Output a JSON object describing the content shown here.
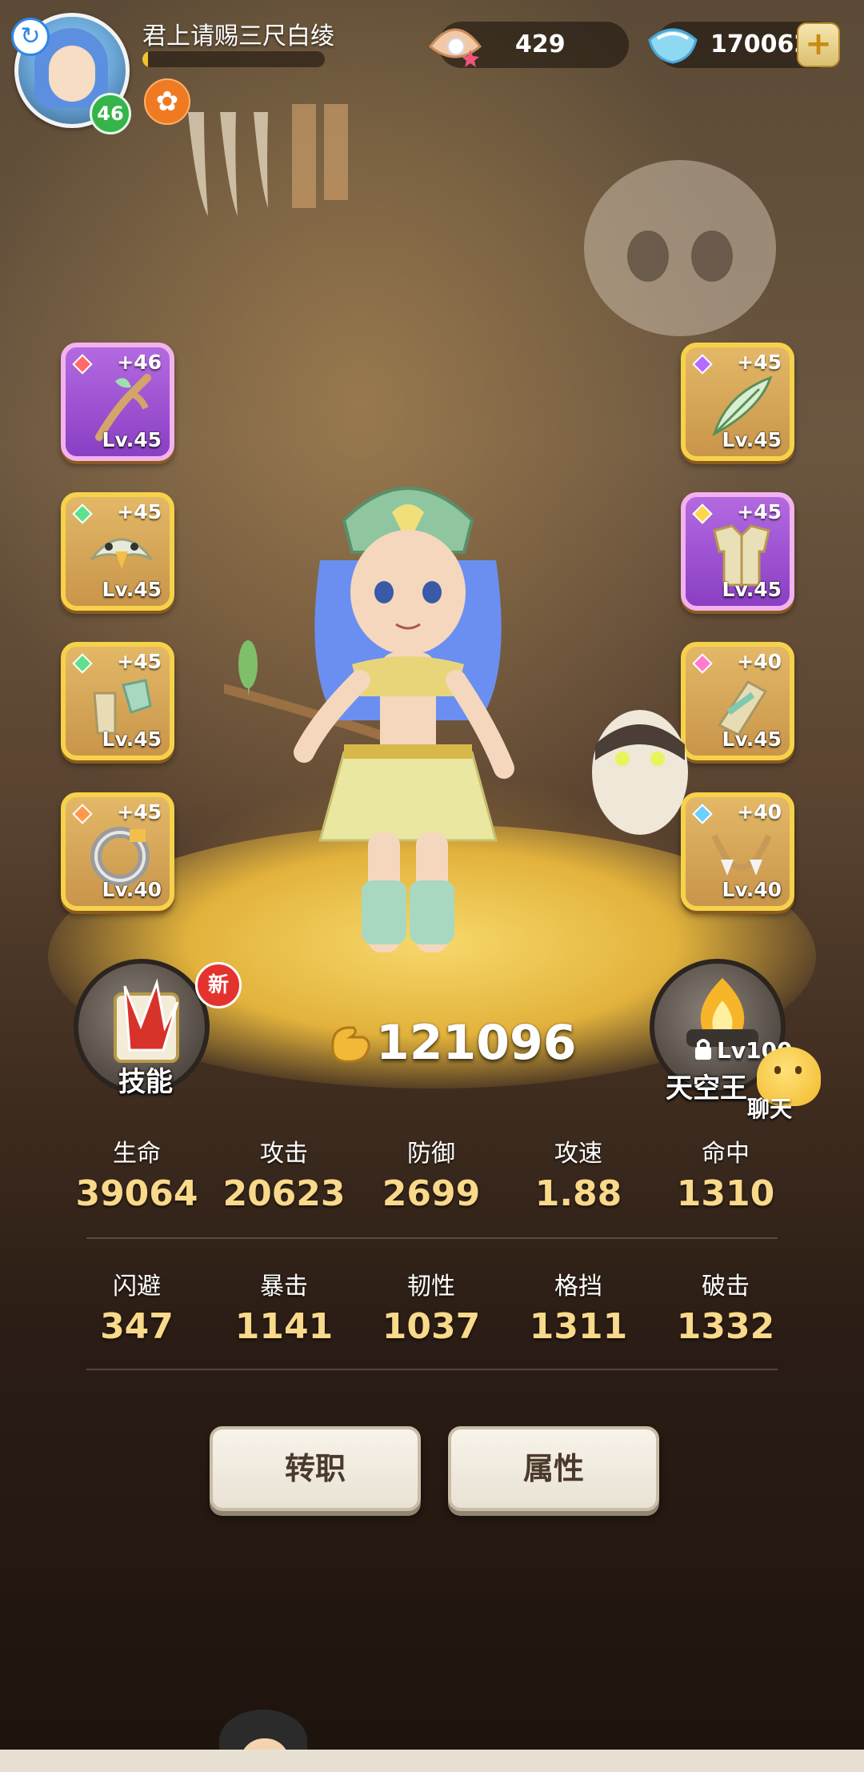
{
  "header": {
    "player_name": "君上请赐三尺白绫",
    "level": "46",
    "exp_fraction": 0.03,
    "pearl_amount": "429",
    "diamond_amount": "170062",
    "refresh_icon": "refresh-icon",
    "buff_icon": "buff-icon",
    "plus_icon": "plus-icon"
  },
  "equipment": {
    "left": [
      {
        "plus": "+46",
        "level": "Lv.45",
        "rarity": "purple",
        "gem_color": "#ff6a6a",
        "item": "staff"
      },
      {
        "plus": "+45",
        "level": "Lv.45",
        "rarity": "gold",
        "gem_color": "#5fe08a",
        "item": "eagle-helmet"
      },
      {
        "plus": "+45",
        "level": "Lv.45",
        "rarity": "gold",
        "gem_color": "#5fe08a",
        "item": "boots"
      },
      {
        "plus": "+45",
        "level": "Lv.40",
        "rarity": "gold",
        "gem_color": "#ff9a4a",
        "item": "ring"
      }
    ],
    "right": [
      {
        "plus": "+45",
        "level": "Lv.45",
        "rarity": "gold",
        "gem_color": "#b46bff",
        "item": "feather"
      },
      {
        "plus": "+45",
        "level": "Lv.45",
        "rarity": "purple",
        "gem_color": "#ffd54a",
        "item": "armor"
      },
      {
        "plus": "+40",
        "level": "Lv.45",
        "rarity": "gold",
        "gem_color": "#ff7ad0",
        "item": "bracer"
      },
      {
        "plus": "+40",
        "level": "Lv.40",
        "rarity": "gold",
        "gem_color": "#6ad0ff",
        "item": "necklace"
      }
    ]
  },
  "skill_button": {
    "label": "技能",
    "new_badge": "新"
  },
  "sky_button": {
    "label": "天空王",
    "lock_text": "Lv100"
  },
  "chat": {
    "label": "聊天"
  },
  "power": "121096",
  "stats_row1": [
    {
      "label": "生命",
      "value": "39064"
    },
    {
      "label": "攻击",
      "value": "20623"
    },
    {
      "label": "防御",
      "value": "2699"
    },
    {
      "label": "攻速",
      "value": "1.88"
    },
    {
      "label": "命中",
      "value": "1310"
    }
  ],
  "stats_row2": [
    {
      "label": "闪避",
      "value": "347"
    },
    {
      "label": "暴击",
      "value": "1141"
    },
    {
      "label": "韧性",
      "value": "1037"
    },
    {
      "label": "格挡",
      "value": "1311"
    },
    {
      "label": "破击",
      "value": "1332"
    }
  ],
  "actions": {
    "transfer": "转职",
    "attributes": "属性"
  }
}
